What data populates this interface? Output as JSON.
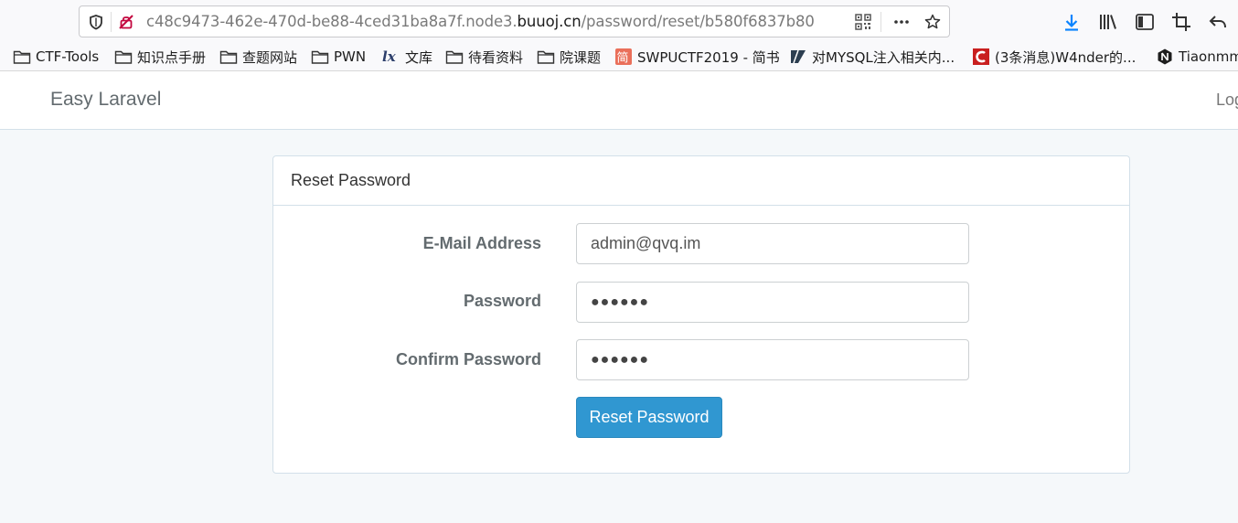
{
  "browser": {
    "url_prefix": "c48c9473-462e-470d-be88-4ced31ba8a7f.node3.",
    "url_domain": "buuoj.cn",
    "url_path": "/password/reset/b580f6837b80",
    "bookmarks": [
      {
        "label": "CTF-Tools",
        "icon": "folder-icon"
      },
      {
        "label": "知识点手册",
        "icon": "folder-icon"
      },
      {
        "label": "查题网站",
        "icon": "folder-icon"
      },
      {
        "label": "PWN",
        "icon": "folder-icon"
      },
      {
        "label": "文库",
        "icon": "lx-icon"
      },
      {
        "label": "待看资料",
        "icon": "folder-icon"
      },
      {
        "label": "院课题",
        "icon": "folder-icon"
      },
      {
        "label": "SWPUCTF2019 - 简书",
        "icon": "jianshu-icon"
      },
      {
        "label": "对MYSQL注入相关内...",
        "icon": "zhihu-icon"
      },
      {
        "label": "(3条消息)W4nder的...",
        "icon": "csdn-icon"
      },
      {
        "label": "Tiaonmm",
        "icon": "notion-icon"
      }
    ]
  },
  "navbar": {
    "brand": "Easy Laravel",
    "login": "Login"
  },
  "panel": {
    "title": "Reset Password",
    "fields": [
      {
        "label": "E-Mail Address",
        "value": "admin@qvq.im"
      },
      {
        "label": "Password",
        "value": "●●●●●●"
      },
      {
        "label": "Confirm Password",
        "value": "●●●●●●"
      }
    ],
    "submit": "Reset Password"
  },
  "colors": {
    "primary": "#3097d1",
    "page_bg": "#f5f8fa",
    "border": "#d3e0e9"
  }
}
